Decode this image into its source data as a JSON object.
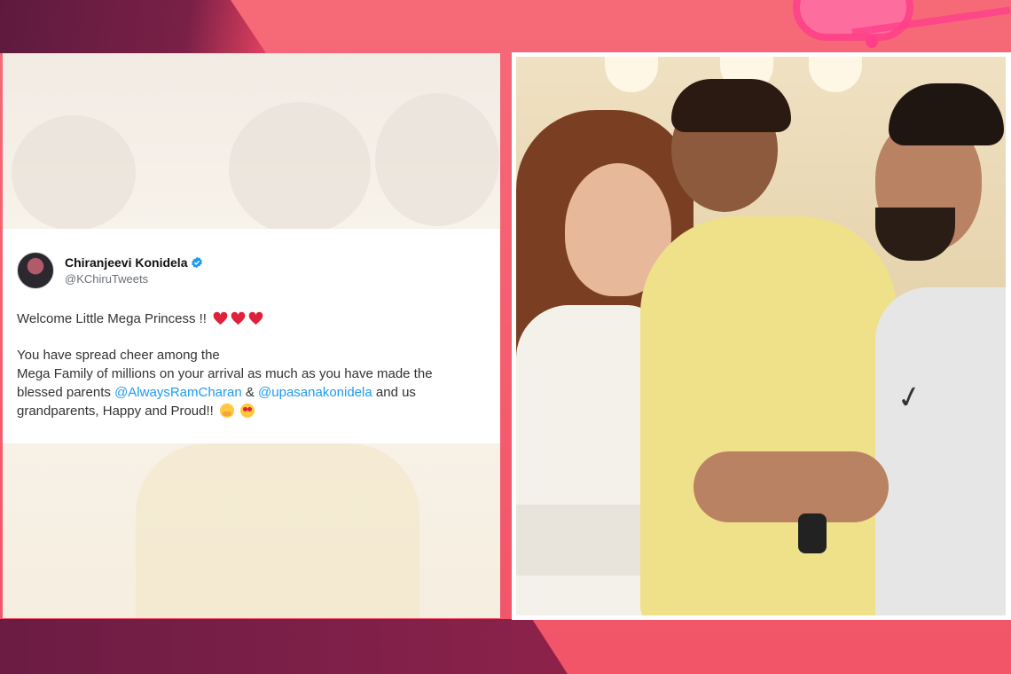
{
  "tweet": {
    "author_name": "Chiranjeevi Konidela",
    "author_handle": "@KChiruTweets",
    "line1": "Welcome Little Mega Princess !!",
    "para2_line1": "You have spread cheer among the",
    "para2_line2": "Mega Family of millions on your arrival as much as you have made the",
    "para2_line3_prefix": "blessed parents",
    "mention1": "@AlwaysRamCharan",
    "amp": "&",
    "mention2": "@upasanakonidela",
    "para2_line3_suffix": "and us",
    "para2_line4": "grandparents, Happy and Proud!!"
  },
  "icons": {
    "verified": "verified-badge-icon",
    "heart": "red-heart-emoji",
    "hug": "hugging-face-emoji",
    "heart_eyes": "heart-eyes-emoji"
  },
  "colors": {
    "mention": "#1d9bf0",
    "background_pink": "#f25a6e",
    "background_dark": "#6b1c43"
  }
}
